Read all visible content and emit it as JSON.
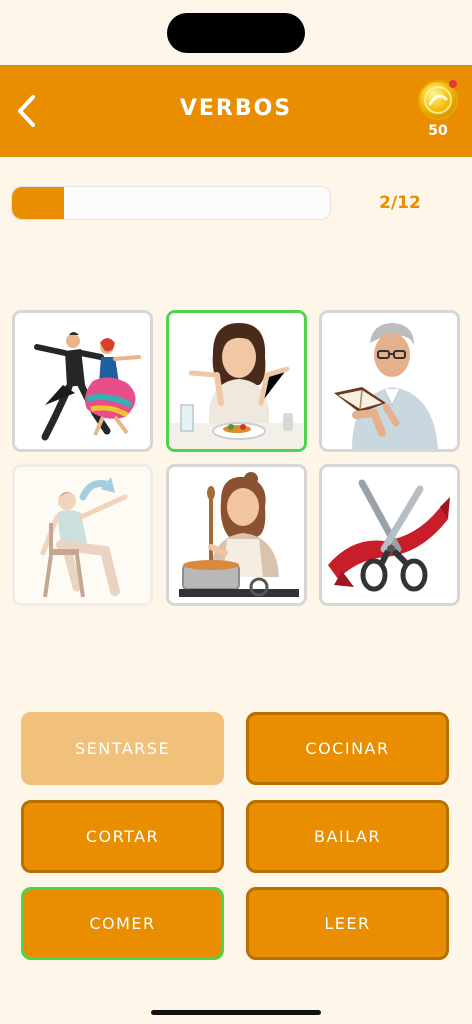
{
  "header": {
    "title": "VERBOS",
    "coins": "50"
  },
  "progress": {
    "current": 2,
    "total": 12,
    "text": "2/12",
    "fill_fraction": 0.165
  },
  "images": [
    {
      "id": "dancers",
      "icon": "dancing-couple-image",
      "state": "normal"
    },
    {
      "id": "eating",
      "icon": "woman-eating-image",
      "state": "selected"
    },
    {
      "id": "reading",
      "icon": "man-reading-image",
      "state": "normal"
    },
    {
      "id": "sitting",
      "icon": "woman-sitting-image",
      "state": "faded"
    },
    {
      "id": "cooking",
      "icon": "woman-cooking-image",
      "state": "normal"
    },
    {
      "id": "cutting",
      "icon": "scissors-cutting-ribbon-image",
      "state": "normal"
    }
  ],
  "answers": [
    {
      "label": "SENTARSE",
      "state": "used"
    },
    {
      "label": "COCINAR",
      "state": "normal"
    },
    {
      "label": "CORTAR",
      "state": "normal"
    },
    {
      "label": "BAILAR",
      "state": "normal"
    },
    {
      "label": "COMER",
      "state": "correct"
    },
    {
      "label": "LEER",
      "state": "normal"
    }
  ],
  "colors": {
    "accent": "#e88e00",
    "background": "#fdf6e9",
    "correct": "#4cd44c",
    "used": "#f1c07a"
  }
}
